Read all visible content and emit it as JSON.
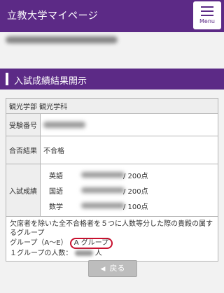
{
  "header": {
    "title": "立教大学マイページ",
    "menu_label": "Menu"
  },
  "section": {
    "title": "入試成績結果開示"
  },
  "result": {
    "faculty": "観光学部 観光学科",
    "exam_number_label": "受験番号",
    "pass_label": "合否結果",
    "pass_value": "不合格",
    "score_label": "入試成績",
    "scores": [
      {
        "subject": "英語",
        "max": "/ 200点"
      },
      {
        "subject": "国語",
        "max": "/ 200点"
      },
      {
        "subject": "数学",
        "max": "/ 100点"
      }
    ],
    "note": "欠席者を除いた全不合格者を５つに人数等分した際の貴殿の属するグループ",
    "group_label": "グループ（A〜E）",
    "group_value": "A グループ",
    "group_count_label": "１グループの人数：",
    "group_count_suffix": "人"
  },
  "back_button": {
    "label": "戻る"
  },
  "colors": {
    "brand": "#5c2a86",
    "highlight": "#c8102e"
  }
}
